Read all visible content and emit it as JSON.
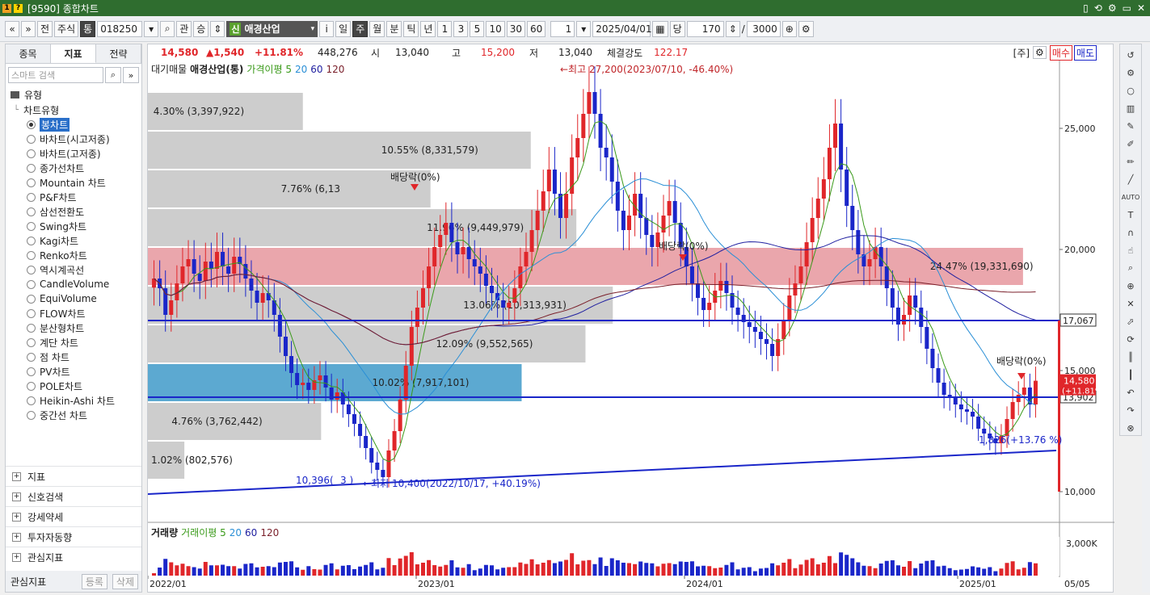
{
  "window": {
    "title": "[9590] 종합차트",
    "icon_1": "1",
    "icon_2": "?",
    "controls": [
      "▯",
      "⟲",
      "⚙",
      "▭",
      "✕"
    ]
  },
  "toolbar": {
    "nav_prev": "«",
    "nav_next": "»",
    "btn_all": "전",
    "btn_stock": "주식",
    "btn_tong": "통",
    "code_value": "018250",
    "btn_gwan": "관",
    "btn_seung": "승",
    "stock_badge": "신",
    "stock_name": "애경산업",
    "btn_info": "i",
    "periods": [
      "일",
      "주",
      "월",
      "분",
      "틱",
      "년"
    ],
    "selected_period": "주",
    "minutes": [
      "1",
      "3",
      "5",
      "10",
      "30",
      "60"
    ],
    "interval_value": "1",
    "date_value": "2025/04/01",
    "btn_dang": "당",
    "count_value": "170",
    "slash": "/",
    "total_value": "3000"
  },
  "left_panel": {
    "tabs": [
      "종목",
      "지표",
      "전략"
    ],
    "selected_tab": "지표",
    "search_placeholder": "스마트 검색",
    "section_type": "유형",
    "chart_type_head": "차트유형",
    "chart_types": [
      "봉차트",
      "바차트(시고저종)",
      "바차트(고저종)",
      "종가선차트",
      "Mountain 차트",
      "P&F차트",
      "삼선전환도",
      "Swing차트",
      "Kagi차트",
      "Renko차트",
      "역시계곡선",
      "CandleVolume",
      "EquiVolume",
      "FLOW차트",
      "분산형차트",
      "계단 차트",
      "점 차트",
      "PV차트",
      "POLE차트",
      "Heikin-Ashi 차트",
      "중간선 차트"
    ],
    "selected_type": "봉차트",
    "sections": [
      "지표",
      "신호검색",
      "강세약세",
      "투자자동향",
      "관심지표"
    ],
    "bottom_label": "관심지표",
    "bottom_btn_add": "등록",
    "bottom_btn_del": "삭제"
  },
  "infobar": {
    "price": "14,580",
    "change": "▲1,540",
    "change_pct": "+11.81%",
    "volume": "448,276",
    "open_label": "시",
    "open": "13,040",
    "high_label": "고",
    "high": "15,200",
    "low_label": "저",
    "low": "13,040",
    "strength_label": "체결강도",
    "strength": "122.17",
    "unit_label": "[주]",
    "buy": "매수",
    "sell": "매도"
  },
  "legend": {
    "item1": "대기매물",
    "item2": "애경산업(통)",
    "item3": "가격이평 5",
    "item4": "20",
    "item5": "60",
    "item6": "120"
  },
  "vol_legend": {
    "item1": "거래량",
    "item2": "거래이평 5",
    "item3": "20",
    "item4": "60",
    "item5": "120"
  },
  "colors": {
    "up": "#e0262a",
    "down": "#1a26c9",
    "ma5": "#3a9a1a",
    "ma20": "#2a8fd6",
    "ma60": "#2020a0",
    "ma120": "#7a1f2a",
    "band_gray": "#c8c8c8",
    "band_pink": "#e6969e",
    "band_blue": "#4aa0cc"
  },
  "chart_data": {
    "type": "candlestick",
    "x_ticks": [
      "2022/01",
      "2023/01",
      "2024/01",
      "2025/01",
      "05/05"
    ],
    "y_ticks": [
      "25,000",
      "20,000",
      "15,000",
      "10,000"
    ],
    "y_range": [
      8800,
      27800
    ],
    "vol_tick": "3,000K",
    "last_price_label": "14,580",
    "last_pct_label": "(+11.81%)",
    "line_17067": "17,067",
    "line_13902": "13,902",
    "annotations": {
      "high": "←최고 27,200(2023/07/10, -46.40%)",
      "low": "←최저 10,400(2022/10/17, +40.19%)",
      "low_left": "10,396(",
      "low_left2": "3 )",
      "recent": "1,826(+13.76 %)",
      "div1": "배당락(0%)",
      "div2": "배당락(0%)",
      "div3": "배당락(0%)"
    },
    "volume_profile": [
      {
        "label": "4.30% (3,397,922)",
        "price_lo": 24900,
        "price_hi": 26500,
        "width_pct": 0.17,
        "color": "gray"
      },
      {
        "label": "10.55% (8,331,579)",
        "price_lo": 23300,
        "price_hi": 24900,
        "width_pct": 0.42,
        "color": "gray"
      },
      {
        "label": "7.76% (6,13",
        "price_lo": 21700,
        "price_hi": 23300,
        "width_pct": 0.31,
        "color": "gray"
      },
      {
        "label": "11.96% (9,449,979)",
        "price_lo": 20100,
        "price_hi": 21700,
        "width_pct": 0.47,
        "color": "gray"
      },
      {
        "label": "24.47% (19,331,690)",
        "price_lo": 18500,
        "price_hi": 20100,
        "width_pct": 0.96,
        "color": "pink"
      },
      {
        "label": "13.06% (10,313,931)",
        "price_lo": 16900,
        "price_hi": 18500,
        "width_pct": 0.51,
        "color": "gray"
      },
      {
        "label": "12.09% (9,552,565)",
        "price_lo": 15300,
        "price_hi": 16900,
        "width_pct": 0.48,
        "color": "gray"
      },
      {
        "label": "10.02% (7,917,101)",
        "price_lo": 13700,
        "price_hi": 15300,
        "width_pct": 0.41,
        "color": "blue"
      },
      {
        "label": "4.76% (3,762,442)",
        "price_lo": 12100,
        "price_hi": 13700,
        "width_pct": 0.19,
        "color": "gray"
      },
      {
        "label": "1.02% (802,576)",
        "price_lo": 10500,
        "price_hi": 12100,
        "width_pct": 0.04,
        "color": "gray"
      }
    ],
    "close_series": [
      18800,
      18400,
      17300,
      17900,
      18600,
      19300,
      19600,
      19000,
      18700,
      19500,
      19200,
      19900,
      19300,
      19000,
      19700,
      19400,
      18800,
      18300,
      17800,
      18200,
      17900,
      17300,
      16400,
      15600,
      14900,
      14400,
      14500,
      14200,
      14600,
      14800,
      14300,
      13800,
      14100,
      13600,
      13200,
      12800,
      12300,
      11800,
      11200,
      10900,
      10600,
      11700,
      12500,
      13800,
      15200,
      16800,
      17600,
      18400,
      19300,
      20100,
      20600,
      21100,
      20300,
      19800,
      20100,
      19600,
      19300,
      19000,
      18500,
      18200,
      17900,
      17600,
      17800,
      18400,
      19300,
      19900,
      20800,
      21600,
      22400,
      23300,
      22300,
      21300,
      22300,
      23800,
      24600,
      25600,
      26500,
      25600,
      24200,
      23800,
      22800,
      21600,
      20800,
      21400,
      22300,
      21300,
      20600,
      20100,
      20700,
      21400,
      22000,
      21100,
      20100,
      19300,
      18600,
      18000,
      17500,
      17800,
      18300,
      18700,
      18200,
      17600,
      17300,
      17000,
      16800,
      16600,
      16300,
      16100,
      15600,
      16300,
      17100,
      18100,
      18600,
      19300,
      20300,
      21300,
      22100,
      22900,
      24200,
      25200,
      23300,
      21800,
      20800,
      19800,
      19300,
      19600,
      20100,
      19300,
      18400,
      17600,
      16900,
      17300,
      18100,
      17600,
      16800,
      15900,
      15100,
      14500,
      14000,
      13900,
      13600,
      13400,
      13300,
      13100,
      12600,
      12400,
      12200,
      12000,
      12300,
      13000,
      13700,
      14000,
      14300,
      13600,
      14580
    ]
  }
}
